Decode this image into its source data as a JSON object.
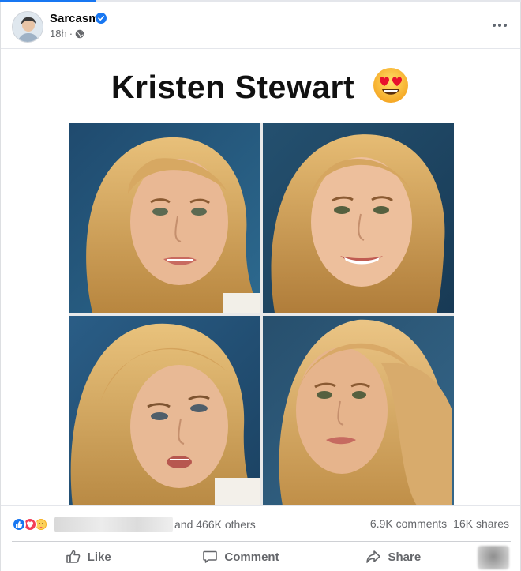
{
  "post": {
    "page_name": "Sarcasm",
    "time": "18h",
    "separator": "·",
    "verified": true
  },
  "image": {
    "title": "Kristen Stewart",
    "title_emoji": "heart-eyes-emoji",
    "tiles": [
      "portrait-photo",
      "portrait-photo",
      "portrait-photo",
      "portrait-photo"
    ]
  },
  "stats": {
    "reaction_icons": [
      "like-icon",
      "love-icon",
      "care-icon"
    ],
    "others_text": "and 466K others",
    "comments": "6.9K comments",
    "shares": "16K shares"
  },
  "actions": {
    "like": "Like",
    "comment": "Comment",
    "share": "Share"
  },
  "colors": {
    "accent": "#1877f2",
    "like_blue": "#1877f2",
    "love_red": "#f33e58",
    "care_yellow": "#f7b125",
    "muted_text": "#65676b"
  }
}
